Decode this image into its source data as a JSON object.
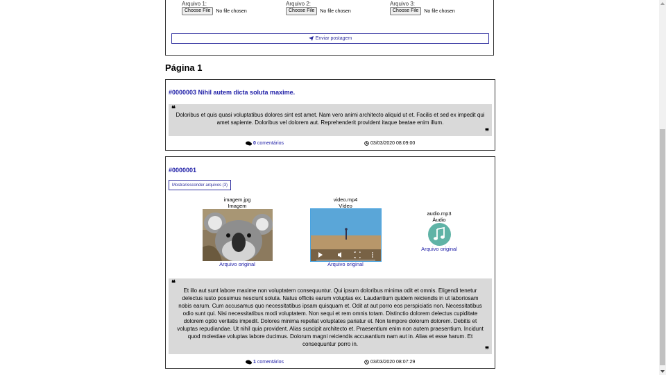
{
  "upload_form": {
    "files": [
      {
        "label": "Arquivo 1:",
        "button": "Choose File",
        "status": "No file chosen"
      },
      {
        "label": "Arquivo 2:",
        "button": "Choose File",
        "status": "No file chosen"
      },
      {
        "label": "Arquivo 3:",
        "button": "Choose File",
        "status": "No file chosen"
      }
    ],
    "submit_label": "Enviar postagem"
  },
  "page_title": "Página 1",
  "posts": [
    {
      "id_title": "#0000003 Nihil autem dicta soluta maxime.",
      "body": "Doloribus et quis quasi voluptatibus dolores sint est amet. Nam vero animi architecto aliquid ut et. Facilis et sed ex impedit qui amet sapiente. Doloribus vel dolorem aut. Reprehenderit provident itaque beatae enim illum.",
      "comment_count": "0",
      "comments_label": "comentários",
      "timestamp": "03/03/2020 08:09:00"
    },
    {
      "id_title": "#0000001",
      "toggle_label": "Mostrar/esconder arquivos (3)",
      "attachments": [
        {
          "filename": "imagem.jpg",
          "type": "Imagem",
          "link": "Arquivo original"
        },
        {
          "filename": "video.mp4",
          "type": "Vídeo",
          "link": "Arquivo original"
        },
        {
          "filename": "audio.mp3",
          "type": "Áudio",
          "link": "Arquivo original"
        }
      ],
      "body": "Et illo aut sunt labore maxime non voluptatem consequuntur. Qui ipsum doloribus minima odit et omnis. Eligendi tenetur delectus iusto possimus nesciunt soluta. Natus officiis earum voluptas ex. Laudantium quidem reiciendis in ut laboriosam nobis earum. Cum accusamus quo necessitatibus ipsam quisquam et. Odit at aut porro eos perspiciatis non. Necessitatibus odio sunt qui. Nisi necessitatibus modi voluptatem. Non sequi et rem omnis totam. Distinctio dolorem delectus cupiditate dolorem optio veritatis impedit. Dolores minima repellat voluptates pariatur et. Non tempore dolorum dolorem. Debitis et voluptas repudiandae. Ut nihil quia provident. Alias suscipit architecto et. Praesentium enim non autem praesentium. Incidunt quod molestiae voluptas labore ducimus. Dolorum magni reiciendis accusantium nam aut in. Alias et esse harum. Et consequuntur porro in.",
      "comment_count": "1",
      "comments_label": "comentários",
      "timestamp": "03/03/2020 08:07:29"
    }
  ],
  "colors": {
    "link": "#1c1ca6",
    "quote_bg": "#d9d9d9",
    "audio_icon": "#5fb3a6"
  }
}
